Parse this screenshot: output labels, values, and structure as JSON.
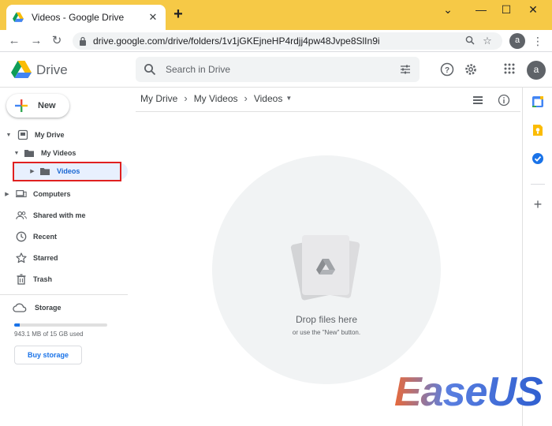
{
  "browser": {
    "tab_title": "Videos - Google Drive",
    "tab_close": "✕",
    "new_tab": "+",
    "url": "drive.google.com/drive/folders/1v1jGKEjneHP4rdjj4pw48Jvpe8SlIn9i",
    "profile_initial": "a",
    "window_controls": [
      "⌄",
      "—",
      "☐",
      "✕"
    ],
    "nav": {
      "back": "←",
      "forward": "→",
      "reload": "↻"
    }
  },
  "drive": {
    "product_name": "Drive",
    "search_placeholder": "Search in Drive",
    "avatar_initial": "a"
  },
  "sidebar": {
    "new_label": "New",
    "tree": {
      "my_drive": "My Drive",
      "my_videos": "My Videos",
      "videos": "Videos"
    },
    "items": [
      {
        "label": "Computers",
        "icon": "computers-icon"
      },
      {
        "label": "Shared with me",
        "icon": "shared-icon"
      },
      {
        "label": "Recent",
        "icon": "clock-icon"
      },
      {
        "label": "Starred",
        "icon": "star-icon"
      },
      {
        "label": "Trash",
        "icon": "trash-icon"
      }
    ],
    "storage": {
      "label": "Storage",
      "used_text": "943.1 MB of 15 GB used",
      "used_fraction": 0.0614,
      "buy_label": "Buy storage"
    }
  },
  "main": {
    "breadcrumb": [
      "My Drive",
      "My Videos",
      "Videos"
    ],
    "breadcrumb_sep": "›",
    "drop_title": "Drop files here",
    "drop_subtitle": "or use the \"New\" button."
  },
  "colors": {
    "chrome_tabbar": "#f6c946",
    "selection": "#e8f0fe",
    "accent_blue": "#1a73e8",
    "highlight_red": "#e02020"
  },
  "watermark": {
    "text": "EaseUS"
  }
}
